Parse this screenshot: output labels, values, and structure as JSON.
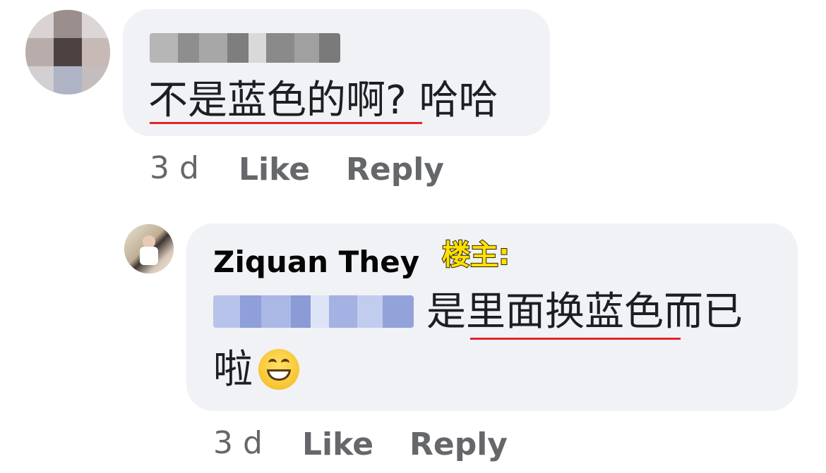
{
  "comments": [
    {
      "author": "",
      "text_underlined": "不是蓝色的啊?",
      "text_rest": " 哈哈",
      "time": "3 d",
      "like_label": "Like",
      "reply_label": "Reply"
    },
    {
      "author": "Ziquan They",
      "tag": "楼主:",
      "text_line1_prefix": "是",
      "text_line1_underlined": "里面换蓝色",
      "text_line1_rest": "而已",
      "text_line2": "啦",
      "emoji": "grinning-face-icon",
      "time": "3 d",
      "like_label": "Like",
      "reply_label": "Reply"
    }
  ],
  "colors": {
    "bubble": "#f0f2f5",
    "meta_text": "#65676b",
    "underline": "#e3242b",
    "tag": "#ffe000"
  }
}
